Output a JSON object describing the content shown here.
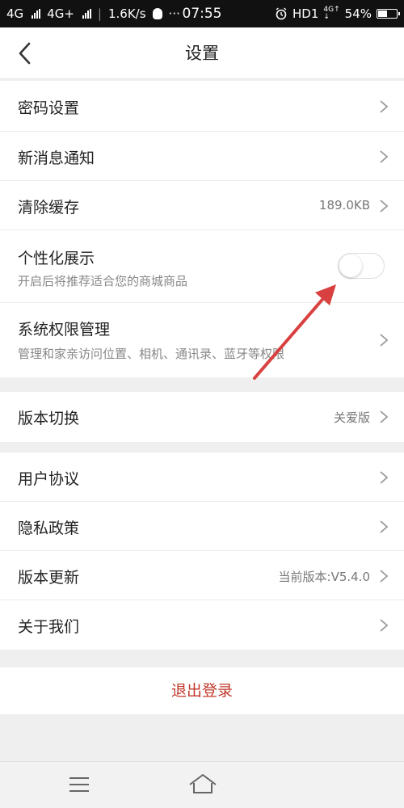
{
  "status_bar": {
    "network1": "4G",
    "network2": "4G+",
    "speed": "1.6K/s",
    "dots": "···",
    "time": "07:55",
    "hd": "HD1",
    "battery": "54%",
    "battery_level": 0.54
  },
  "header": {
    "title": "设置"
  },
  "sections": {
    "main": [
      {
        "label": "密码设置"
      },
      {
        "label": "新消息通知"
      },
      {
        "label": "清除缓存",
        "value": "189.0KB"
      },
      {
        "label": "个性化展示",
        "sub": "开启后将推荐适合您的商城商品",
        "toggle_on": false
      },
      {
        "label": "系统权限管理",
        "sub": "管理和家亲访问位置、相机、通讯录、蓝牙等权限"
      }
    ],
    "version_switch": {
      "label": "版本切换",
      "value": "关爱版"
    },
    "about": [
      {
        "label": "用户协议"
      },
      {
        "label": "隐私政策"
      },
      {
        "label": "版本更新",
        "value": "当前版本:V5.4.0"
      },
      {
        "label": "关于我们"
      }
    ]
  },
  "logout": {
    "label": "退出登录"
  },
  "colors": {
    "accent": "#c0392b",
    "arrow": "#d94040"
  }
}
